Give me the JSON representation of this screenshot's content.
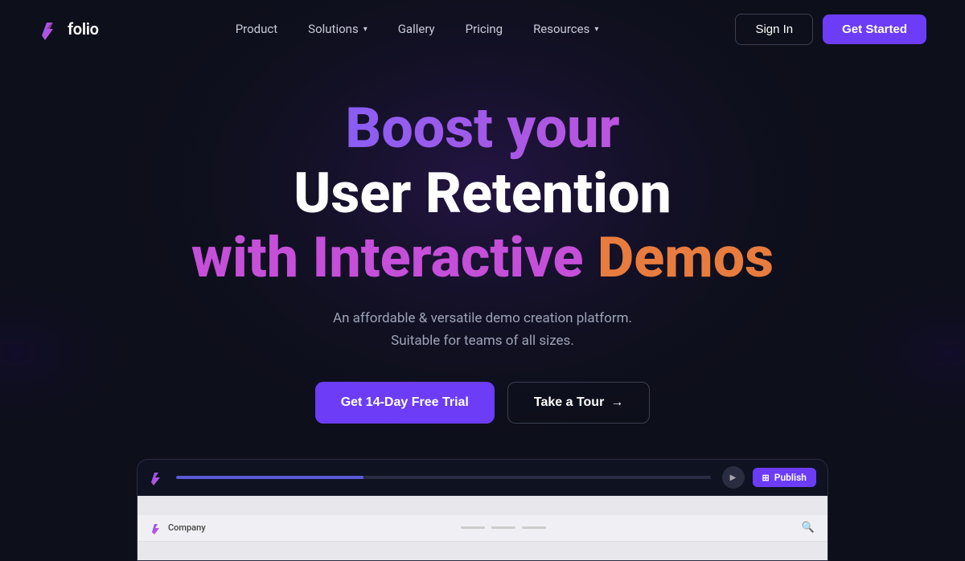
{
  "brand": {
    "name": "folio",
    "logo_alt": "folio logo"
  },
  "nav": {
    "links": [
      {
        "label": "Product",
        "has_dropdown": false
      },
      {
        "label": "Solutions",
        "has_dropdown": true
      },
      {
        "label": "Gallery",
        "has_dropdown": false
      },
      {
        "label": "Pricing",
        "has_dropdown": false
      },
      {
        "label": "Resources",
        "has_dropdown": true
      }
    ],
    "signin_label": "Sign In",
    "getstarted_label": "Get Started"
  },
  "hero": {
    "line1": "Boost your",
    "line2": "User Retention",
    "line3_part1": "with Interactive",
    "line3_part2": "Demos",
    "subtitle_line1": "An affordable & versatile demo creation platform.",
    "subtitle_line2": "Suitable for teams of all sizes.",
    "cta_primary": "Get 14-Day Free Trial",
    "cta_secondary": "Take a Tour",
    "cta_secondary_arrow": "→"
  },
  "app_preview": {
    "publish_label": "Publish",
    "company_label": "Company"
  },
  "colors": {
    "bg": "#0d0f1a",
    "accent_purple": "#6c3cf7",
    "hero_gradient_start": "#6c63ff",
    "hero_gradient_end": "#d94fd1",
    "hero_line3_purple": "#c54fd9",
    "hero_line3_orange": "#e87c3e"
  }
}
